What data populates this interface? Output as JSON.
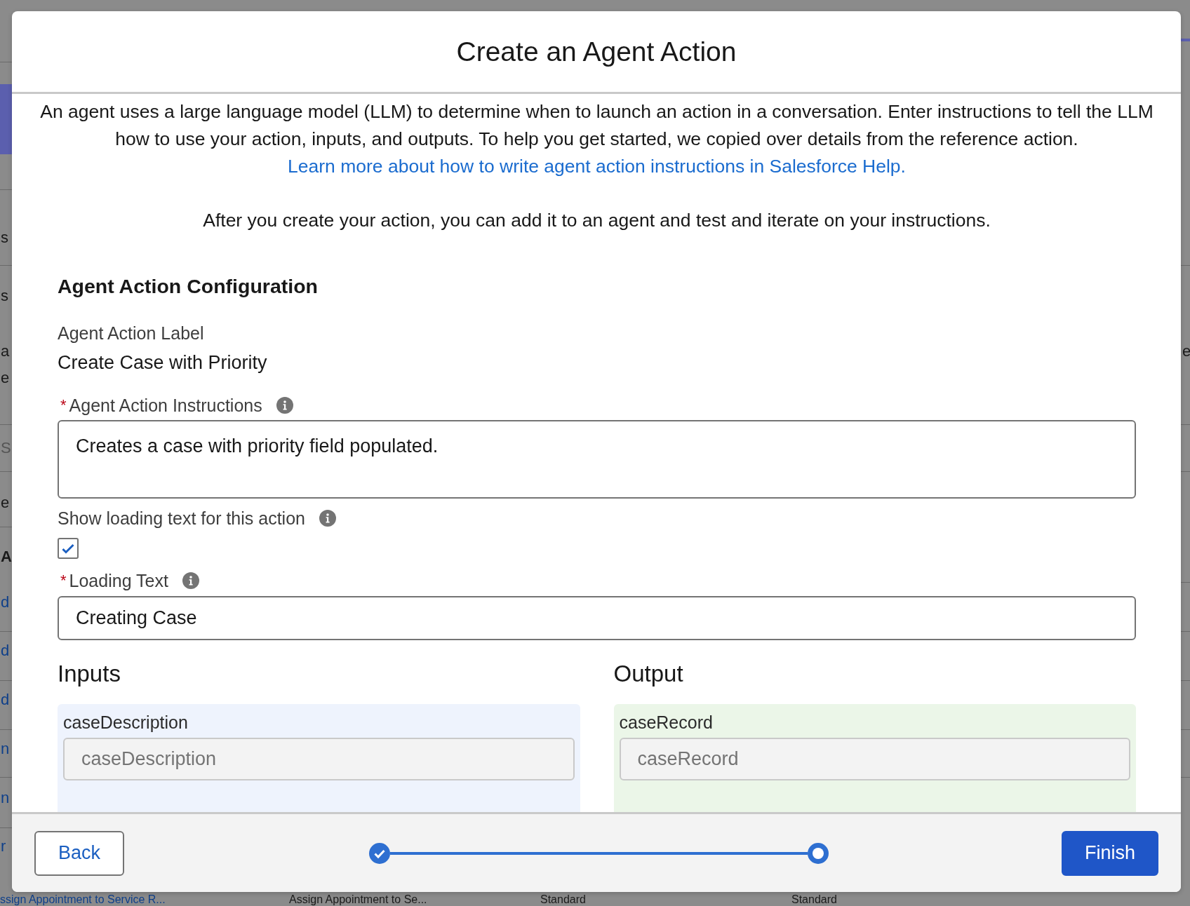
{
  "background": {
    "left_fragments": [
      {
        "text": "s",
        "kind": "text"
      },
      {
        "text": "s",
        "kind": "text"
      },
      {
        "text": "a",
        "kind": "text"
      },
      {
        "text": "e",
        "kind": "text"
      },
      {
        "text": "S",
        "kind": "muted"
      },
      {
        "text": "e",
        "kind": "text"
      },
      {
        "text": "A",
        "kind": "heading"
      },
      {
        "text": "d",
        "kind": "link"
      },
      {
        "text": "d",
        "kind": "link"
      },
      {
        "text": "d",
        "kind": "link"
      },
      {
        "text": "n",
        "kind": "link"
      },
      {
        "text": "n",
        "kind": "link"
      },
      {
        "text": "r",
        "kind": "link"
      }
    ],
    "right_fragments": [
      {
        "text": "e",
        "kind": "text"
      }
    ],
    "bottom_row": [
      {
        "text": "ssign Appointment to Service R...",
        "kind": "link"
      },
      {
        "text": "Assign Appointment to Se...",
        "kind": "text"
      },
      {
        "text": "Standard",
        "kind": "text"
      },
      {
        "text": "Standard",
        "kind": "text"
      }
    ]
  },
  "modal": {
    "title": "Create an Agent Action",
    "intro": "An agent uses a large language model (LLM) to determine when to launch an action in a conversation. Enter instructions to tell the LLM how to use your action, inputs, and outputs. To help you get started, we copied over details from the reference action. ",
    "intro_link": "Learn more about how to write agent action instructions in Salesforce Help.",
    "note": "After you create your action, you can add it to an agent and test and iterate on your instructions.",
    "section_title": "Agent Action Configuration",
    "label_field": {
      "label": "Agent Action Label",
      "value": "Create Case with Priority"
    },
    "instructions": {
      "required_mark": "*",
      "label": "Agent Action Instructions",
      "value": "Creates a case with priority field populated."
    },
    "show_loading": {
      "label": "Show loading text for this action",
      "checked": true
    },
    "loading_text": {
      "required_mark": "*",
      "label": "Loading Text",
      "value": "Creating Case"
    },
    "inputs": {
      "title": "Inputs",
      "items": [
        {
          "name": "caseDescription",
          "value": "caseDescription"
        }
      ]
    },
    "output": {
      "title": "Output",
      "items": [
        {
          "name": "caseRecord",
          "value": "caseRecord"
        }
      ]
    }
  },
  "footer": {
    "back": "Back",
    "finish": "Finish",
    "steps": [
      {
        "kind": "complete"
      },
      {
        "kind": "current"
      }
    ]
  }
}
